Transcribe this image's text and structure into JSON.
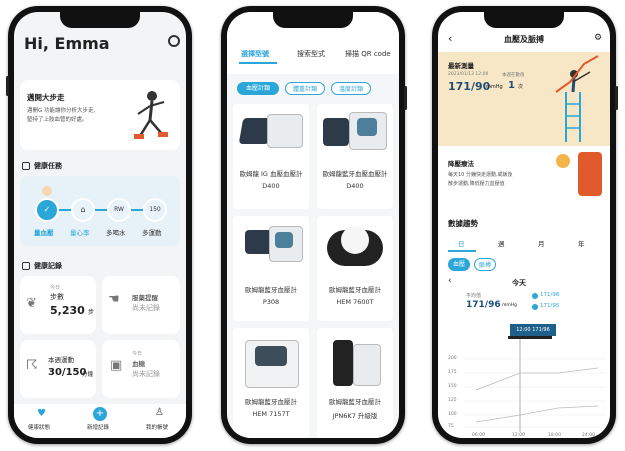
{
  "phone1": {
    "greeting": "Hi, Emma",
    "banner_title": "邁開大步走",
    "banner_line1": "邁開G 功能讓你分析大步走,",
    "banner_line2": "堅持了上肢血管的好處。",
    "section_plan": "健康任務",
    "steps": [
      {
        "label": "量血壓",
        "icon": "✓"
      },
      {
        "label": "量心率",
        "icon": "⌂"
      },
      {
        "label": "多喝水",
        "icon": "RW"
      },
      {
        "label": "多運動",
        "icon": "150"
      }
    ],
    "section_records": "健康記錄",
    "tiles": [
      {
        "small": "今日",
        "label": "步數",
        "value": "5,230",
        "unit": "步"
      },
      {
        "small": "",
        "label": "服藥提醒",
        "value": "尚未記錄",
        "unit": ""
      },
      {
        "small": "",
        "label": "本週運動",
        "value": "30/150",
        "unit": "分鐘"
      },
      {
        "small": "今日",
        "label": "血糖",
        "value": "尚未記錄",
        "unit": ""
      }
    ],
    "nav": [
      "健康狀態",
      "新增記錄",
      "我的帳號"
    ]
  },
  "phone2": {
    "tabs": [
      "選擇型號",
      "搜索型式",
      "掃描 QR code"
    ],
    "filters": [
      "血壓計類",
      "體重計類",
      "溫度計類"
    ],
    "products": [
      {
        "name": "歐姆龍 IG 血壓血壓計",
        "model": "D400"
      },
      {
        "name": "歐姆龍藍牙血壓血壓計",
        "model": "D400"
      },
      {
        "name": "歐姆龍藍牙血壓計",
        "model": "P308"
      },
      {
        "name": "歐姆龍藍牙血壓計",
        "model": "HEM 7600T"
      },
      {
        "name": "歐姆龍藍牙血壓計",
        "model": "HEM 7157T"
      },
      {
        "name": "歐姆龍藍牙血壓計",
        "model": "JPN6K7 升級版"
      }
    ]
  },
  "phone3": {
    "title": "血壓及脈搏",
    "card1_title": "最新測量",
    "card1_date": "2023/01/13 12:00",
    "card1_label2": "本週在數值",
    "card1_value": "171/90",
    "card1_unit": "mmHg",
    "card1_value2": "1",
    "card1_unit2": "次",
    "card2_title": "降壓療法",
    "card2_line1": "每天10 分鐘快走運動,或飯後",
    "card2_line2": "散步運動,降低壓力血壓值",
    "section_trend": "數據趨勢",
    "range_tabs": [
      "日",
      "週",
      "月",
      "年"
    ],
    "toggles": [
      "血壓",
      "脈搏"
    ],
    "day_label": "今天",
    "avg_label": "平均值",
    "avg_value": "171/96",
    "avg_unit": "mmHg",
    "legend": [
      "171/96",
      "171/95"
    ],
    "tooltip": "12:00 171/96",
    "y_ticks": [
      "200",
      "175",
      "150",
      "125",
      "100",
      "75"
    ],
    "x_ticks": [
      "06:00",
      "12:00",
      "18:00",
      "24:00"
    ],
    "colors": {
      "accent": "#2aa6d8",
      "cream": "#f7e7c6"
    }
  }
}
